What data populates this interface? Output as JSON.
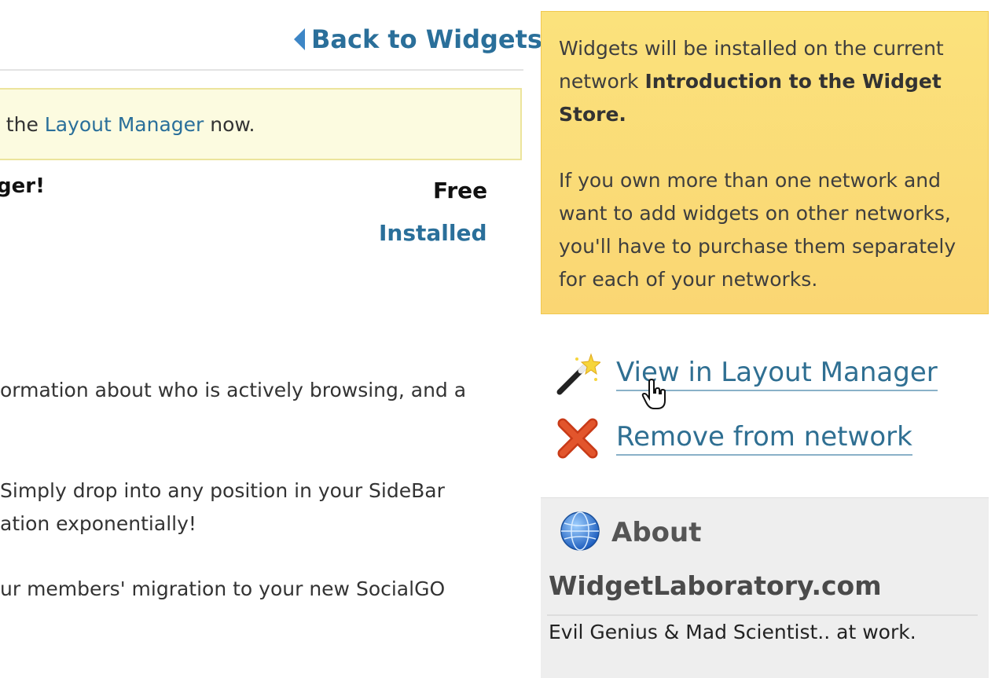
{
  "header": {
    "back_link": "Back to Widgets"
  },
  "notice": {
    "prefix": "n the ",
    "link": "Layout Manager",
    "suffix": " now."
  },
  "widget": {
    "title_fragment": "ger!",
    "price": "Free",
    "status": "Installed",
    "description_lines": [
      "ormation about who is actively browsing, and a",
      " Simply drop into any position in your SideBar",
      "ation exponentially!",
      "ur members' migration to your new SocialGO"
    ]
  },
  "sidebar": {
    "info_text_1": "Widgets will be installed on the current network ",
    "info_network_name": "Introduction to the Widget Store",
    "info_text_1_end": ".",
    "info_text_2": "If you own more than one network and want to add widgets on other networks, you'll have to purchase them separately for each of your networks.",
    "actions": [
      {
        "label": "View in Layout Manager",
        "icon": "magic-wand-icon"
      },
      {
        "label": "Remove from network",
        "icon": "red-x-icon"
      }
    ],
    "about": {
      "title": "About",
      "icon": "globe-icon",
      "author": "WidgetLaboratory.com",
      "tagline": "Evil Genius & Mad Scientist.. at work."
    }
  },
  "colors": {
    "link": "#2a6f9a",
    "info_box": "#fbe27c",
    "notice_bg": "#fcfbe0",
    "about_bg": "#eeeeee"
  }
}
